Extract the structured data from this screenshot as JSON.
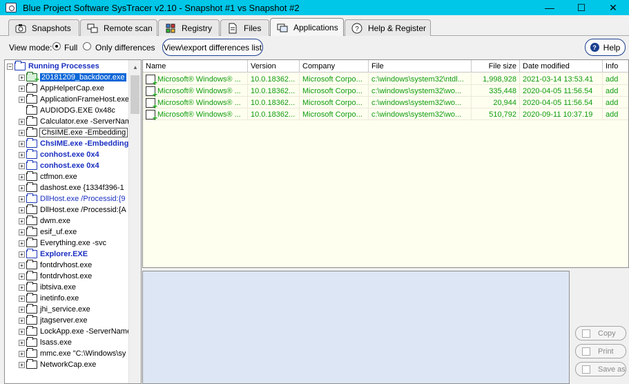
{
  "window": {
    "title": "Blue Project Software SysTracer v2.10 - Snapshot #1 vs Snapshot #2",
    "minimize_glyph": "—",
    "maximize_glyph": "☐",
    "close_glyph": "✕"
  },
  "tabs": [
    {
      "label": "Snapshots",
      "icon": "camera-icon",
      "active": false
    },
    {
      "label": "Remote scan",
      "icon": "remote-scan-icon",
      "active": false
    },
    {
      "label": "Registry",
      "icon": "registry-icon",
      "active": false
    },
    {
      "label": "Files",
      "icon": "file-icon",
      "active": false
    },
    {
      "label": "Applications",
      "icon": "applications-icon",
      "active": true
    },
    {
      "label": "Help & Register",
      "icon": "help-icon",
      "active": false
    }
  ],
  "toolbar": {
    "view_mode_label": "View mode:",
    "full_label": "Full",
    "full_selected": true,
    "only_diff_label": "Only differences",
    "only_diff_selected": false,
    "export_button": "View\\export differences list",
    "help_button": "Help"
  },
  "tree": {
    "root": {
      "label": "Running Processes",
      "expander": "−"
    },
    "items": [
      {
        "label": "20181209_backdoor.exe",
        "expander": "+",
        "style": "sel",
        "folder": "green"
      },
      {
        "label": "AppHelperCap.exe",
        "expander": "+",
        "style": "",
        "folder": ""
      },
      {
        "label": "ApplicationFrameHost.exe",
        "expander": "+",
        "style": "",
        "folder": ""
      },
      {
        "label": "AUDIODG.EXE 0x48c",
        "expander": "",
        "style": "",
        "folder": ""
      },
      {
        "label": "Calculator.exe -ServerName",
        "expander": "+",
        "style": "",
        "folder": ""
      },
      {
        "label": "ChsIME.exe -Embedding",
        "expander": "+",
        "style": "focus",
        "folder": ""
      },
      {
        "label": "ChsIME.exe -Embedding",
        "expander": "+",
        "style": "bluebold",
        "folder": "blue"
      },
      {
        "label": "conhost.exe 0x4",
        "expander": "+",
        "style": "bluebold",
        "folder": "blue"
      },
      {
        "label": "conhost.exe 0x4",
        "expander": "+",
        "style": "bluebold",
        "folder": "blue"
      },
      {
        "label": "ctfmon.exe",
        "expander": "+",
        "style": "",
        "folder": ""
      },
      {
        "label": "dashost.exe {1334f396-1",
        "expander": "+",
        "style": "",
        "folder": ""
      },
      {
        "label": "DllHost.exe /Processid:{9",
        "expander": "+",
        "style": "bluenormal",
        "folder": "blue"
      },
      {
        "label": "DllHost.exe /Processid:{A",
        "expander": "+",
        "style": "",
        "folder": ""
      },
      {
        "label": "dwm.exe",
        "expander": "+",
        "style": "",
        "folder": ""
      },
      {
        "label": "esif_uf.exe",
        "expander": "+",
        "style": "",
        "folder": ""
      },
      {
        "label": "Everything.exe -svc",
        "expander": "+",
        "style": "",
        "folder": ""
      },
      {
        "label": "Explorer.EXE",
        "expander": "+",
        "style": "bluebold",
        "folder": "blue"
      },
      {
        "label": "fontdrvhost.exe",
        "expander": "+",
        "style": "",
        "folder": ""
      },
      {
        "label": "fontdrvhost.exe",
        "expander": "+",
        "style": "",
        "folder": ""
      },
      {
        "label": "ibtsiva.exe",
        "expander": "+",
        "style": "",
        "folder": ""
      },
      {
        "label": "inetinfo.exe",
        "expander": "+",
        "style": "",
        "folder": ""
      },
      {
        "label": "jhi_service.exe",
        "expander": "+",
        "style": "",
        "folder": ""
      },
      {
        "label": "jtagserver.exe",
        "expander": "+",
        "style": "",
        "folder": ""
      },
      {
        "label": "LockApp.exe -ServerName",
        "expander": "+",
        "style": "",
        "folder": ""
      },
      {
        "label": "lsass.exe",
        "expander": "+",
        "style": "",
        "folder": ""
      },
      {
        "label": "mmc.exe \"C:\\Windows\\sy",
        "expander": "+",
        "style": "",
        "folder": ""
      },
      {
        "label": "NetworkCap.exe",
        "expander": "+",
        "style": "",
        "folder": ""
      }
    ]
  },
  "grid": {
    "columns": [
      "Name",
      "Version",
      "Company",
      "File",
      "File size",
      "Date modified",
      "Info"
    ],
    "rows": [
      [
        "Microsoft® Windows® ...",
        "10.0.18362...",
        "Microsoft Corpo...",
        "c:\\windows\\system32\\ntdl...",
        "1,998,928",
        "2021-03-14 13:53.41",
        "add"
      ],
      [
        "Microsoft® Windows® ...",
        "10.0.18362...",
        "Microsoft Corpo...",
        "c:\\windows\\system32\\wo...",
        "335,448",
        "2020-04-05 11:56.54",
        "add"
      ],
      [
        "Microsoft® Windows® ...",
        "10.0.18362...",
        "Microsoft Corpo...",
        "c:\\windows\\system32\\wo...",
        "20,944",
        "2020-04-05 11:56.54",
        "add"
      ],
      [
        "Microsoft® Windows® ...",
        "10.0.18362...",
        "Microsoft Corpo...",
        "c:\\windows\\system32\\wo...",
        "510,792",
        "2020-09-11 10:37.19",
        "add"
      ]
    ]
  },
  "side_buttons": {
    "copy": "Copy",
    "print": "Print",
    "save_as": "Save as"
  },
  "colors": {
    "titlebar": "#00c7e8",
    "added_green": "#0e9b0e",
    "highlight_blue": "#1a2fc0",
    "selection": "#0a66d8"
  }
}
